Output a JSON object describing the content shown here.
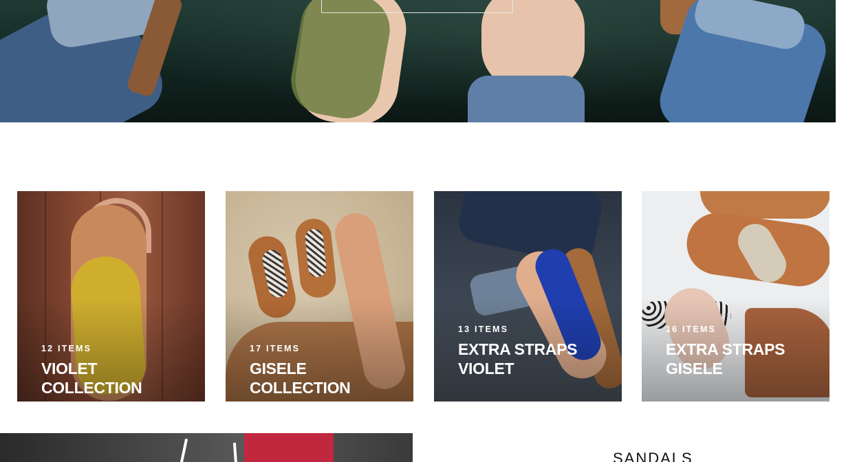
{
  "collections": [
    {
      "count": "12 ITEMS",
      "title_lines": [
        "VIOLET COLLECTION"
      ]
    },
    {
      "count": "17 ITEMS",
      "title_lines": [
        "GISELE COLLECTION"
      ]
    },
    {
      "count": "13 ITEMS",
      "title_lines": [
        "EXTRA STRAPS",
        "VIOLET"
      ]
    },
    {
      "count": "16 ITEMS",
      "title_lines": [
        "EXTRA STRAPS",
        "GISELE"
      ]
    }
  ],
  "section": {
    "heading": "SANDALS"
  },
  "colors": {
    "text_on_image": "#ffffff",
    "heading": "#111111",
    "background": "#ffffff"
  }
}
